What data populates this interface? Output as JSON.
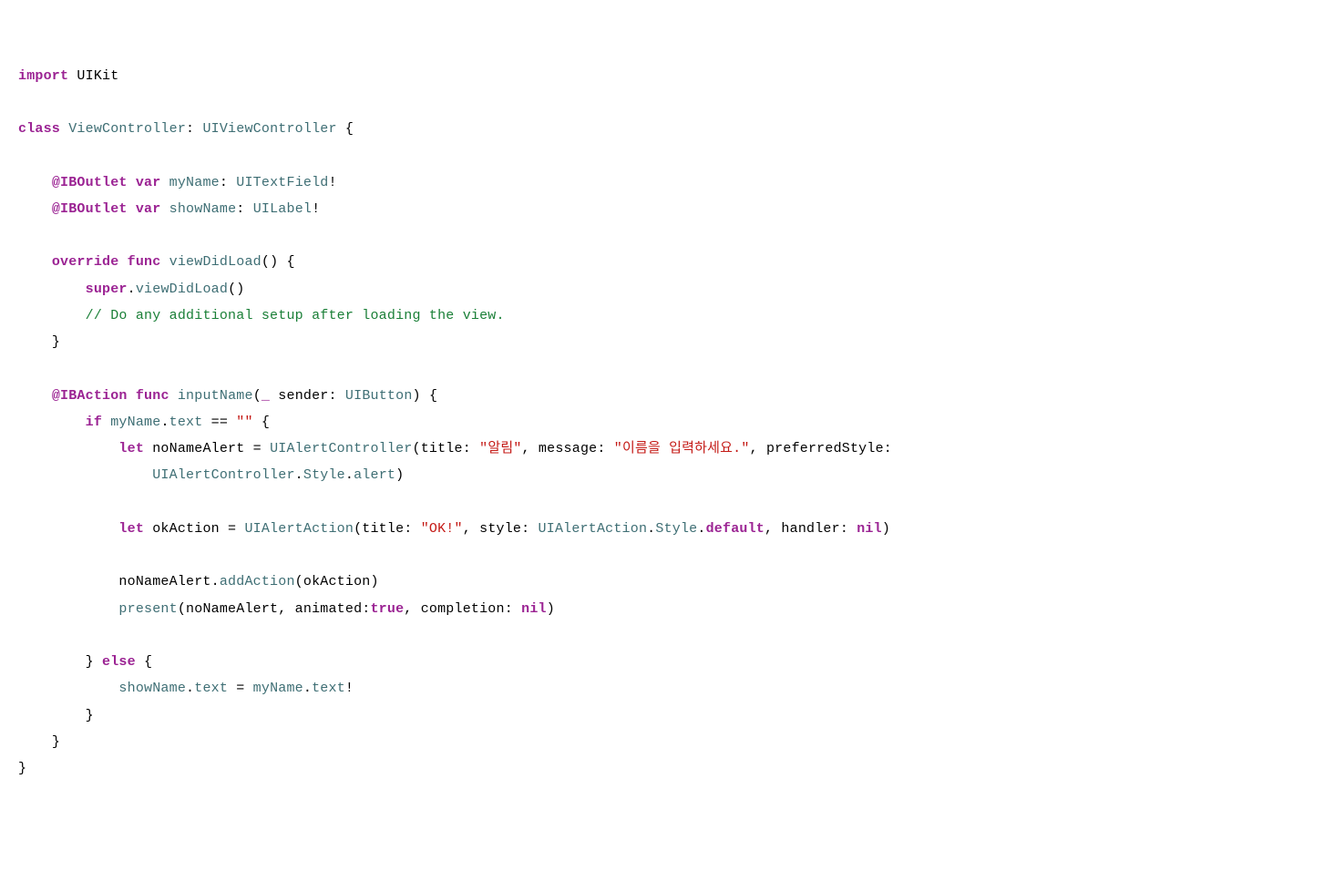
{
  "code": {
    "l1": {
      "t1": "import",
      "t2": "UIKit"
    },
    "l2": {
      "t1": "class",
      "t2": "ViewController",
      "t3": ": ",
      "t4": "UIViewController",
      "t5": " {"
    },
    "l3": {
      "t1": "@IBOutlet",
      "t2": "var",
      "t3": "myName",
      "t4": ": ",
      "t5": "UITextField",
      "t6": "!"
    },
    "l4": {
      "t1": "@IBOutlet",
      "t2": "var",
      "t3": "showName",
      "t4": ": ",
      "t5": "UILabel",
      "t6": "!"
    },
    "l5": {
      "t1": "override",
      "t2": "func",
      "t3": "viewDidLoad",
      "t4": "() {"
    },
    "l6": {
      "t1": "super",
      "t2": ".",
      "t3": "viewDidLoad",
      "t4": "()"
    },
    "l7": {
      "t1": "// Do any additional setup after loading the view."
    },
    "l8": {
      "t1": "}"
    },
    "l9": {
      "t1": "@IBAction",
      "t2": "func",
      "t3": "inputName",
      "t4": "(",
      "t5": "_",
      "t6": " sender: ",
      "t7": "UIButton",
      "t8": ") {"
    },
    "l10": {
      "t1": "if",
      "t2": "myName",
      "t3": ".",
      "t4": "text",
      "t5": " == ",
      "t6": "\"\"",
      "t7": " {"
    },
    "l11": {
      "t1": "let",
      "t2": " noNameAlert = ",
      "t3": "UIAlertController",
      "t4": "(title: ",
      "t5": "\"알림\"",
      "t6": ", message: ",
      "t7": "\"이름을 입력하세요.\"",
      "t8": ", preferredStyle:"
    },
    "l12": {
      "t1": "UIAlertController",
      "t2": ".",
      "t3": "Style",
      "t4": ".",
      "t5": "alert",
      "t6": ")"
    },
    "l13": {
      "t1": "let",
      "t2": " okAction = ",
      "t3": "UIAlertAction",
      "t4": "(title: ",
      "t5": "\"OK!\"",
      "t6": ", style: ",
      "t7": "UIAlertAction",
      "t8": ".",
      "t9": "Style",
      "t10": ".",
      "t11": "default",
      "t12": ", handler: ",
      "t13": "nil",
      "t14": ")"
    },
    "l14": {
      "t1": "noNameAlert.",
      "t2": "addAction",
      "t3": "(okAction)"
    },
    "l15": {
      "t1": "present",
      "t2": "(noNameAlert, animated:",
      "t3": "true",
      "t4": ", completion: ",
      "t5": "nil",
      "t6": ")"
    },
    "l16": {
      "t1": "} ",
      "t2": "else",
      "t3": " {"
    },
    "l17": {
      "t1": "showName",
      "t2": ".",
      "t3": "text",
      "t4": " = ",
      "t5": "myName",
      "t6": ".",
      "t7": "text",
      "t8": "!"
    },
    "l18": {
      "t1": "}"
    },
    "l19": {
      "t1": "}"
    },
    "l20": {
      "t1": "}"
    }
  }
}
